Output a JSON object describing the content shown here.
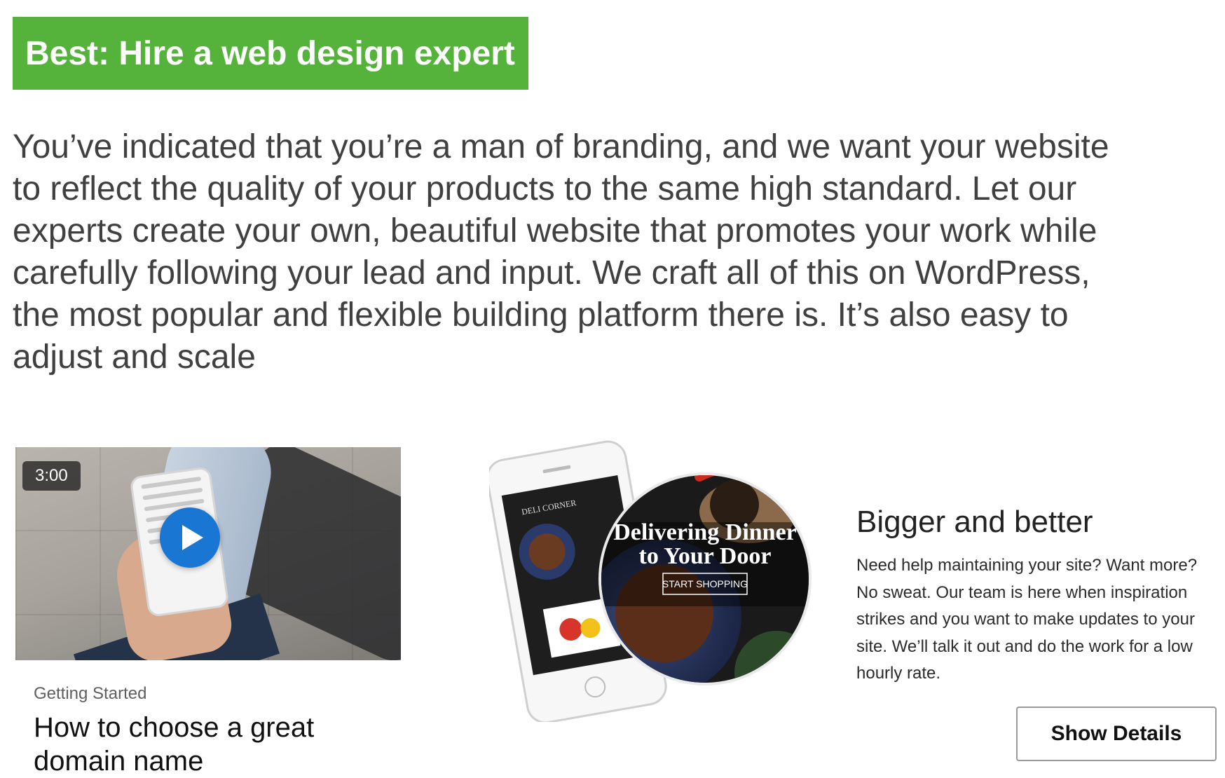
{
  "banner": {
    "title": "Best: Hire a web design expert",
    "color": "#55b33b"
  },
  "intro": "You’ve indicated that you’re a man of branding, and we want your website to reflect the quality of your products to the same high standard. Let our experts create your own, beautiful website that promotes your work while carefully following your lead and input. We craft all of this on WordPress, the most popular and flexible building platform there is. It’s also easy to adjust and scale",
  "video_card": {
    "duration": "3:00",
    "category": "Getting Started",
    "title": "How to choose a great domain name",
    "play_icon": "play-icon",
    "accent": "#1976d2"
  },
  "promo_art": {
    "phone_brand": "DELI CORNER",
    "headline_line1": "Delivering Dinner",
    "headline_line2": "to Your Door",
    "cta": "START SHOPPING"
  },
  "promo": {
    "title": "Bigger and better",
    "text": "Need help maintaining your site? Want more? No sweat. Our team is here when inspiration strikes and you want to make updates to your site. We’ll talk it out and do the work for a low hourly rate.",
    "button_label": "Show Details"
  }
}
